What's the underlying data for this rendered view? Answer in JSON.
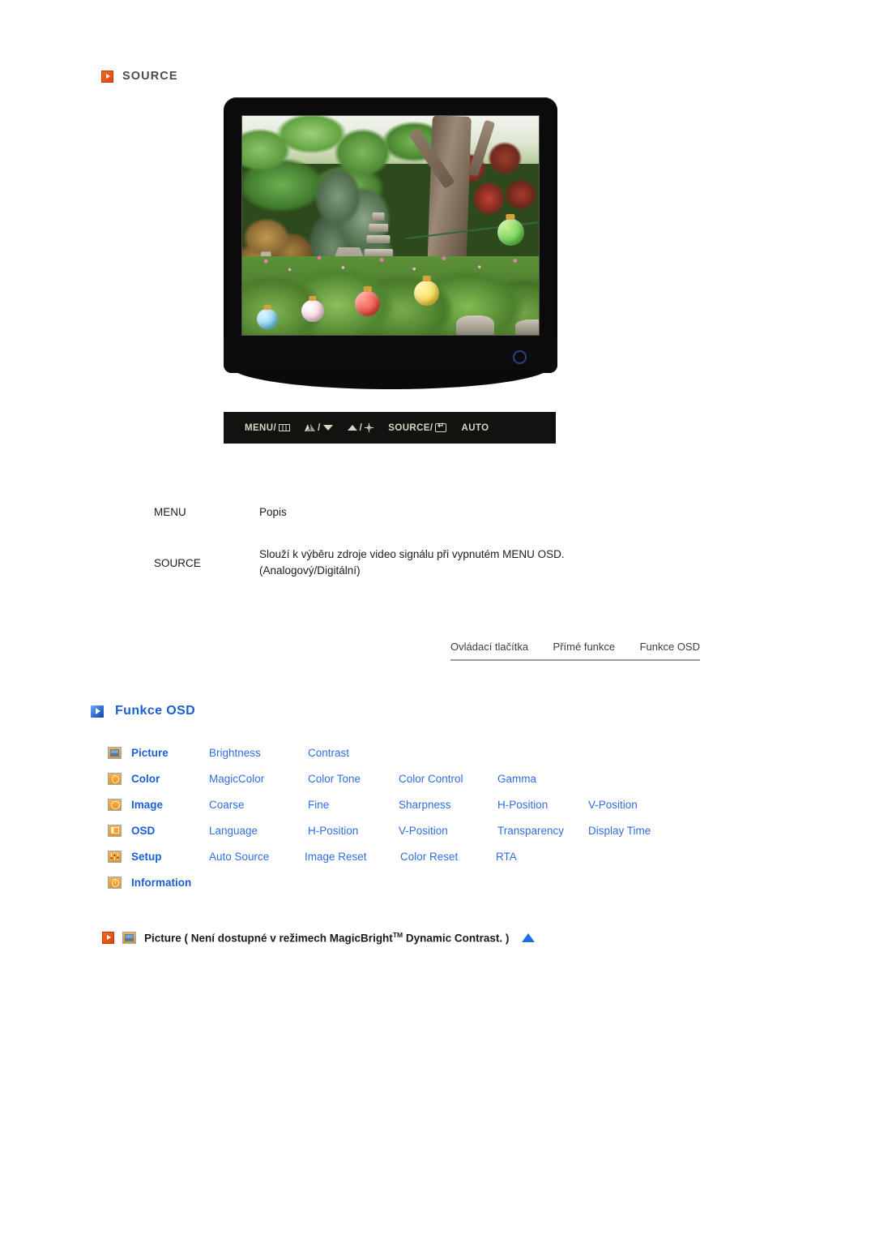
{
  "source_section": {
    "heading": "SOURCE",
    "bullet_icon": "orange-play-bullet-icon",
    "accent_color": "#dd4410"
  },
  "monitor": {
    "screen_image_alt": "Zahradní scéna s kamennou pagodou, stromy a barevnými lampiony",
    "power_led_name": "power-indicator",
    "buttons": [
      {
        "label": "MENU/",
        "glyph": "menu-grid-icon"
      },
      {
        "label": "/",
        "glyph_left": "magicbright-icon",
        "glyph_right": "down-arrow-icon"
      },
      {
        "label": "/",
        "glyph_left": "up-arrow-icon",
        "glyph_right": "brightness-sun-icon"
      },
      {
        "label": "SOURCE/",
        "glyph": "enter-key-icon"
      },
      {
        "label": "AUTO",
        "glyph": ""
      }
    ]
  },
  "desc_table": {
    "headers": {
      "menu": "MENU",
      "description": "Popis"
    },
    "rows": [
      {
        "menu": "SOURCE",
        "description_line1": "Slouží k výběru zdroje video signálu při vypnutém MENU OSD.",
        "description_line2": "(Analogový/Digitální)"
      }
    ]
  },
  "tabs": [
    {
      "label": "Ovládací tlačítka"
    },
    {
      "label": "Přímé funkce"
    },
    {
      "label": "Funkce OSD"
    }
  ],
  "osd_section": {
    "heading": "Funkce OSD",
    "heading_color": "#1b5fd6",
    "bullet_icon": "blue-play-bullet-icon",
    "rows": [
      {
        "icon": "picture-icon",
        "category": "Picture",
        "items": [
          "Brightness",
          "Contrast"
        ]
      },
      {
        "icon": "color-icon",
        "category": "Color",
        "items": [
          "MagicColor",
          "Color Tone",
          "Color Control",
          "Gamma"
        ]
      },
      {
        "icon": "image-icon",
        "category": "Image",
        "items": [
          "Coarse",
          "Fine",
          "Sharpness",
          "H-Position",
          "V-Position"
        ]
      },
      {
        "icon": "osd-icon",
        "category": "OSD",
        "items": [
          "Language",
          "H-Position",
          "V-Position",
          "Transparency",
          "Display Time"
        ]
      },
      {
        "icon": "setup-icon",
        "category": "Setup",
        "items": [
          "Auto Source",
          "Image Reset",
          "Color Reset",
          "RTA"
        ]
      },
      {
        "icon": "information-icon",
        "category": "Information",
        "items": []
      }
    ]
  },
  "picture_note": {
    "bullet_icon": "orange-play-bullet-icon",
    "menu_icon": "picture-icon",
    "text_before": "Picture ( Není dostupné v režimech MagicBright",
    "superscript": "TM",
    "text_after": " Dynamic Contrast. )",
    "scroll_top_icon": "blue-up-triangle-icon"
  }
}
